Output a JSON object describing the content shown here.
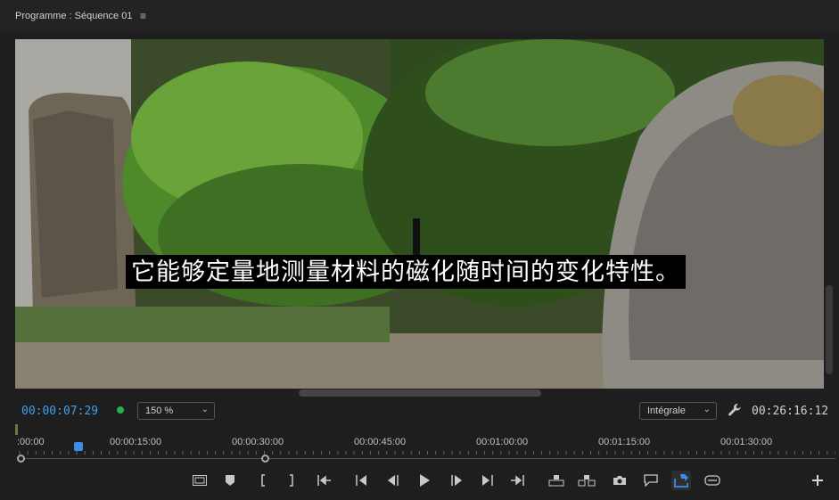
{
  "panel": {
    "title": "Programme : Séquence 01",
    "menu_glyph": "≡"
  },
  "viewer": {
    "subtitle": "它能够定量地测量材料的磁化随时间的变化特性。"
  },
  "controls": {
    "current_timecode": "00:00:07:29",
    "zoom": "150 %",
    "quality": "Intégrale",
    "duration_timecode": "00:26:16:12"
  },
  "ruler": {
    "labels": [
      ":00:00",
      "00:00:15:00",
      "00:00:30:00",
      "00:00:45:00",
      "00:01:00:00",
      "00:01:15:00",
      "00:01:30:00"
    ]
  },
  "transport": {
    "icons": [
      "safe-margins-icon",
      "marker-icon",
      "mark-in-icon",
      "mark-out-icon",
      "go-to-in-icon",
      "step-back-edit-icon",
      "step-back-icon",
      "play-icon",
      "step-forward-icon",
      "step-forward-edit-icon",
      "go-to-out-icon",
      "lift-icon",
      "extract-icon",
      "export-frame-icon",
      "comment-icon",
      "share-icon",
      "vr-icon",
      "add-button-icon"
    ],
    "accent_color": "#3a8ee6"
  }
}
